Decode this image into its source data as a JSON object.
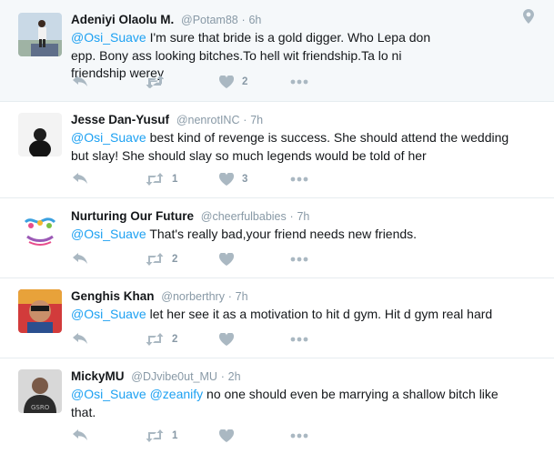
{
  "tweets": [
    {
      "name": "Adeniyi Olaolu M.",
      "handle": "@Potam88",
      "sep": "·",
      "time": "6h",
      "mention": "@Osi_Suave",
      "mention2": "",
      "text": " I'm sure that bride is a gold digger. Who Lepa don epp. Bony ass looking bitches.To hell wit friendship.Ta lo ni friendship werey",
      "retweets": "",
      "likes": "2",
      "has_geo": true
    },
    {
      "name": "Jesse Dan-Yusuf",
      "handle": "@nenrotINC",
      "sep": "·",
      "time": "7h",
      "mention": "@Osi_Suave",
      "mention2": "",
      "text": " best kind of revenge is success. She should attend the wedding but slay! She should slay so much legends would be told of her",
      "retweets": "1",
      "likes": "3"
    },
    {
      "name": "Nurturing Our Future",
      "handle": "@cheerfulbabies",
      "sep": "·",
      "time": "7h",
      "mention": "@Osi_Suave",
      "mention2": "",
      "text": " That's really bad,your friend needs new friends.",
      "retweets": "2",
      "likes": ""
    },
    {
      "name": "Genghis Khan",
      "handle": "@norberthry",
      "sep": "·",
      "time": "7h",
      "mention": "@Osi_Suave",
      "mention2": "",
      "text": " let her see it as a motivation to hit d gym. Hit d gym real hard",
      "retweets": "2",
      "likes": ""
    },
    {
      "name": "MickyMU",
      "handle": "@DJvibe0ut_MU",
      "sep": "·",
      "time": "2h",
      "mention": "@Osi_Suave",
      "mention2": "@zeanify",
      "text": " no one should even be marrying a shallow bitch like that.",
      "retweets": "1",
      "likes": ""
    }
  ],
  "icons": {
    "reply": "reply-icon",
    "retweet": "retweet-icon",
    "like": "heart-icon",
    "more": "more-icon",
    "geo": "location-pin-icon"
  },
  "colors": {
    "mention": "#1da1f2",
    "muted": "#8899a6",
    "icon": "#aab8c2",
    "highlight_bg": "#f5f8fa",
    "border": "#e6ecf0"
  }
}
